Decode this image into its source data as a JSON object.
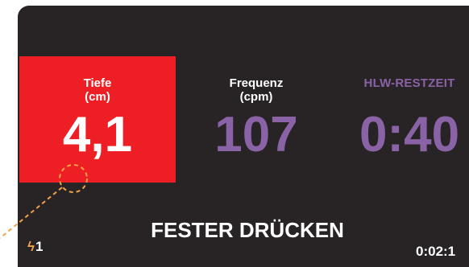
{
  "depth": {
    "label": "Tiefe\n(cm)",
    "value": "4,1"
  },
  "rate": {
    "label": "Frequenz\n(cpm)",
    "value": "107"
  },
  "cpr_time": {
    "label": "HLW-RESTZEIT",
    "value": "0:40"
  },
  "prompt": "FESTER DRÜCKEN",
  "shock_count": "1",
  "elapsed_time": "0:02:1",
  "colors": {
    "screen_bg": "#282425",
    "depth_alert": "#ee1f24",
    "accent_purple": "#8a62a6",
    "callout_orange": "#f0a14a"
  },
  "icons": {
    "shock": "lightning-bolt-icon"
  }
}
